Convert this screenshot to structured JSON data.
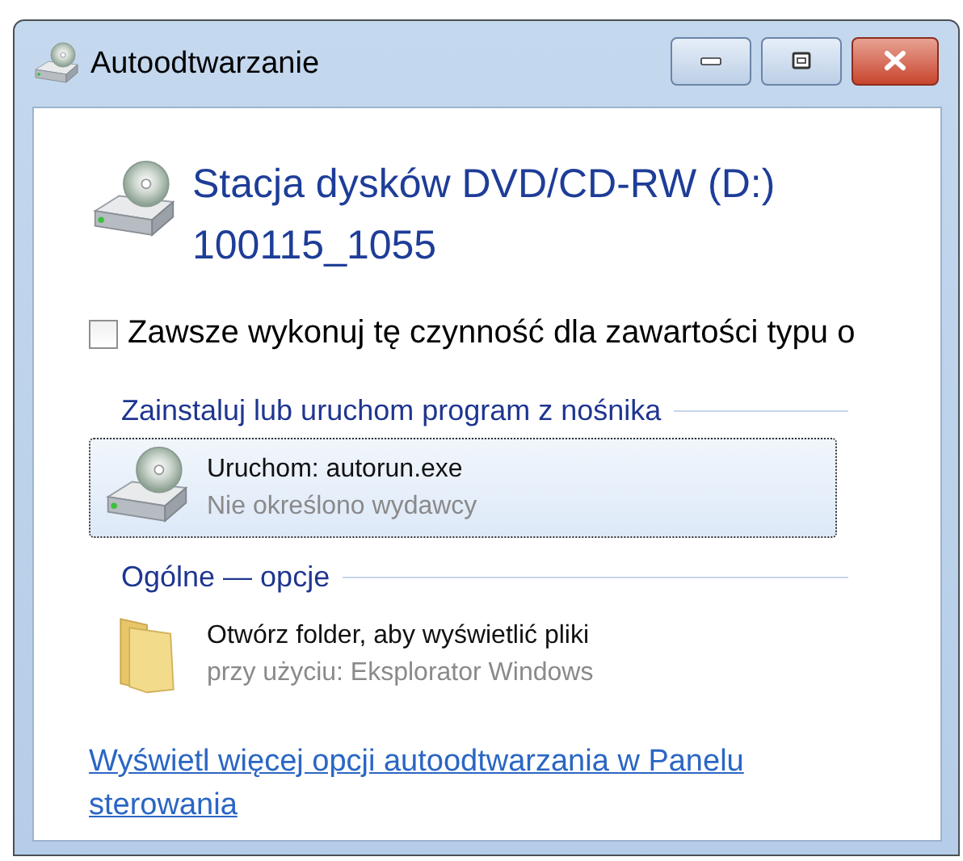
{
  "window": {
    "title": "Autoodtwarzanie",
    "buttons": [
      {
        "kind": "minimize"
      },
      {
        "kind": "maximize"
      },
      {
        "kind": "close"
      }
    ]
  },
  "header": {
    "title": "Stacja dysków DVD/CD-RW (D:)",
    "subtitle": "100115_1055"
  },
  "always_checkbox": {
    "label": "Zawsze wykonuj tę czynność dla zawartości typu o",
    "checked": false
  },
  "sections": [
    {
      "heading": "Zainstaluj lub uruchom program z nośnika",
      "items": [
        {
          "kind": "drive",
          "title": "Uruchom: autorun.exe",
          "detail": "Nie określono wydawcy",
          "selected": true
        }
      ]
    },
    {
      "heading": "Ogólne — opcje",
      "items": [
        {
          "kind": "folder",
          "title": "Otwórz folder, aby wyświetlić pliki",
          "detail": "przy użyciu: Eksplorator Windows",
          "selected": false
        }
      ]
    }
  ],
  "link": "Wyświetl więcej opcji autoodtwarzania w Panelu sterowania"
}
